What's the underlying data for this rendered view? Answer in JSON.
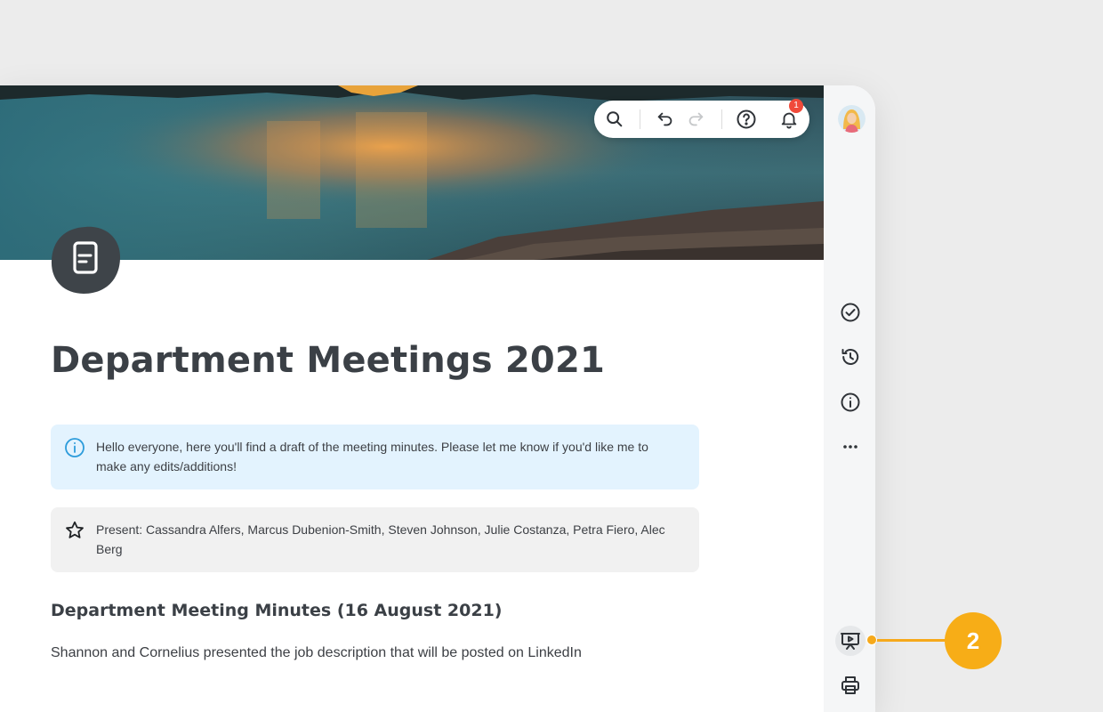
{
  "document": {
    "title": "Department Meetings 2021",
    "info_callout": "Hello everyone, here you'll find a draft of the meeting minutes. Please let me know if you'd like me to make any edits/additions!",
    "attendees_callout": "Present: Cassandra Alfers, Marcus Dubenion-Smith, Steven Johnson, Julie Costanza, Petra Fiero, Alec Berg",
    "section_heading": "Department Meeting Minutes (16 August 2021)",
    "paragraph": "Shannon and Cornelius presented the job description that will be posted on LinkedIn",
    "doc_icon": "document-icon"
  },
  "toolbar": {
    "icons": [
      "search-icon",
      "undo-icon",
      "redo-icon",
      "help-icon",
      "bell-icon"
    ],
    "notification_count": "1"
  },
  "sidebar": {
    "icons": [
      "avatar",
      "check-circle-icon",
      "history-icon",
      "info-icon",
      "more-icon",
      "present-icon",
      "print-icon"
    ]
  },
  "annotation": {
    "marker_number": "2"
  },
  "colors": {
    "accent_marker": "#f7ad17",
    "info_callout_bg": "#e3f3fe",
    "note_callout_bg": "#f1f1f1",
    "badge": "#f04a3a",
    "info_icon": "#2d9cdb"
  }
}
